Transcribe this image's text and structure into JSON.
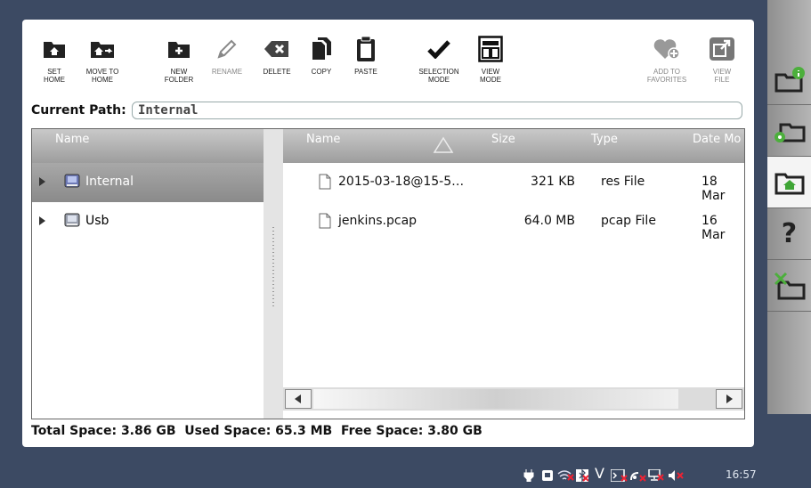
{
  "toolbar": {
    "set_home": "SET\nHOME",
    "move_to_home": "MOVE TO\nHOME",
    "new_folder": "NEW\nFOLDER",
    "rename": "RENAME",
    "delete": "DELETE",
    "copy": "COPY",
    "paste": "PASTE",
    "selection_mode": "SELECTION\nMODE",
    "view_mode": "VIEW\nMODE",
    "add_to_favorites": "ADD TO\nFAVORITES",
    "view_file": "VIEW\nFILE"
  },
  "path": {
    "label": "Current Path:",
    "value": "Internal"
  },
  "tree": {
    "header": "Name",
    "items": [
      {
        "label": "Internal",
        "selected": true
      },
      {
        "label": "Usb",
        "selected": false
      }
    ]
  },
  "files": {
    "headers": {
      "name": "Name",
      "size": "Size",
      "type": "Type",
      "date": "Date Mo"
    },
    "rows": [
      {
        "name": "2015-03-18@15-5…",
        "size": "321 KB",
        "type": "res File",
        "date": "18 Mar"
      },
      {
        "name": "jenkins.pcap",
        "size": "64.0 MB",
        "type": "pcap File",
        "date": "16 Mar"
      }
    ]
  },
  "footer": {
    "text": "Total Space: 3.86 GB  Used Space: 65.3 MB  Free Space: 3.80 GB"
  },
  "status": {
    "clock": "16:57",
    "icons": [
      "power-plug-icon",
      "storage-icon",
      "wifi-off-icon",
      "bluetooth-off-icon",
      "v-icon",
      "terminal-off-icon",
      "satellite-off-icon",
      "network-off-icon",
      "speaker-muted-icon"
    ]
  },
  "sidebar": {
    "icons": [
      "folder-info-icon",
      "folder-settings-icon",
      "folder-home-icon",
      "help-icon",
      "folder-tools-icon"
    ]
  },
  "colors": {
    "background": "#3c4a63",
    "panel": "#ffffff",
    "header_gradient_top": "#c9c9c9",
    "selected_row": "#999999"
  }
}
